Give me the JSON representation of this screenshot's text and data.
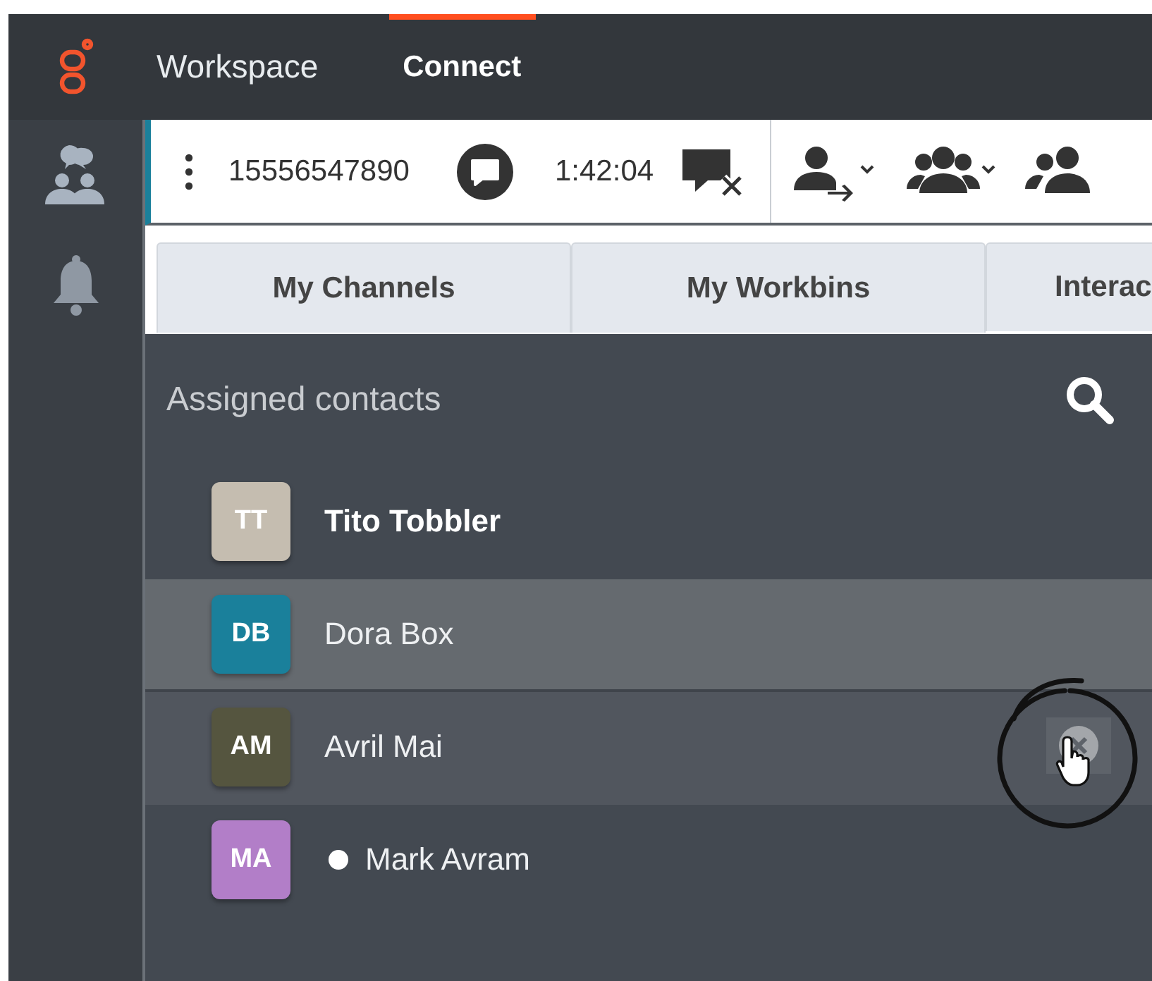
{
  "nav": [
    {
      "label": "Workspace",
      "selected": false
    },
    {
      "label": "Connect",
      "selected": true
    }
  ],
  "sidebar": {
    "items": [
      {
        "kind": "contacts",
        "selected": true
      },
      {
        "kind": "bell",
        "selected": false
      }
    ]
  },
  "interaction_bar": {
    "phone": "15556547890",
    "timer": "1:42:04"
  },
  "tabs": [
    {
      "label": "My Channels",
      "selected": false
    },
    {
      "label": "My Workbins",
      "selected": false
    },
    {
      "label": "Interac",
      "selected": false
    }
  ],
  "contacts": {
    "title": "Assigned contacts",
    "items": [
      {
        "initials": "TT",
        "name": "Tito Tobbler",
        "color": "#c5bdb0",
        "unread": true,
        "selected": false,
        "hovered": false,
        "status_dot": false
      },
      {
        "initials": "DB",
        "name": "Dora Box",
        "color": "#1a809b",
        "unread": false,
        "selected": true,
        "hovered": false,
        "status_dot": false
      },
      {
        "initials": "AM",
        "name": "Avril Mai",
        "color": "#55553f",
        "unread": false,
        "selected": false,
        "hovered": true,
        "status_dot": false
      },
      {
        "initials": "MA",
        "name": "Mark Avram",
        "color": "#b27ec8",
        "unread": false,
        "selected": false,
        "hovered": false,
        "status_dot": true
      }
    ]
  }
}
